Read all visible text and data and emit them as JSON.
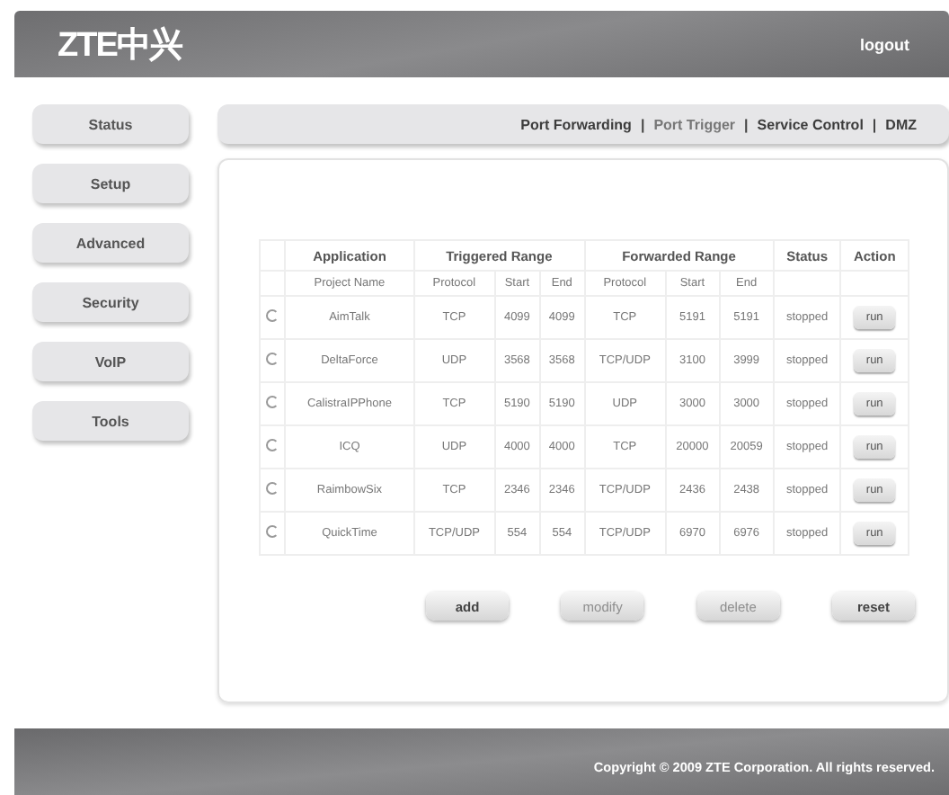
{
  "header": {
    "logo": "ZTE中兴",
    "logout": "logout"
  },
  "sidebar": {
    "items": [
      {
        "label": "Status",
        "selected": false
      },
      {
        "label": "Setup",
        "selected": false
      },
      {
        "label": "Advanced",
        "selected": false
      },
      {
        "label": "Security",
        "selected": false
      },
      {
        "label": "VoIP",
        "selected": false
      },
      {
        "label": "Tools",
        "selected": false
      }
    ]
  },
  "tab_separator": "|",
  "tabs": [
    {
      "label": "Port Forwarding",
      "selected": false
    },
    {
      "label": "Port Trigger",
      "selected": true
    },
    {
      "label": "Service Control",
      "selected": false
    },
    {
      "label": "DMZ",
      "selected": false
    }
  ],
  "table": {
    "groups": [
      "Application",
      "Triggered Range",
      "Forwarded Range",
      "Status",
      "Action"
    ],
    "columns": [
      "Project Name",
      "Protocol",
      "Start",
      "End",
      "Protocol",
      "Start",
      "End"
    ],
    "rows": [
      {
        "selected": false,
        "name": "AimTalk",
        "t_proto": "TCP",
        "t_start": "4099",
        "t_end": "4099",
        "f_proto": "TCP",
        "f_start": "5191",
        "f_end": "5191",
        "status": "stopped",
        "action": "run"
      },
      {
        "selected": false,
        "name": "DeltaForce",
        "t_proto": "UDP",
        "t_start": "3568",
        "t_end": "3568",
        "f_proto": "TCP/UDP",
        "f_start": "3100",
        "f_end": "3999",
        "status": "stopped",
        "action": "run"
      },
      {
        "selected": false,
        "name": "CalistraIPPhone",
        "t_proto": "TCP",
        "t_start": "5190",
        "t_end": "5190",
        "f_proto": "UDP",
        "f_start": "3000",
        "f_end": "3000",
        "status": "stopped",
        "action": "run"
      },
      {
        "selected": false,
        "name": "ICQ",
        "t_proto": "UDP",
        "t_start": "4000",
        "t_end": "4000",
        "f_proto": "TCP",
        "f_start": "20000",
        "f_end": "20059",
        "status": "stopped",
        "action": "run"
      },
      {
        "selected": false,
        "name": "RaimbowSix",
        "t_proto": "TCP",
        "t_start": "2346",
        "t_end": "2346",
        "f_proto": "TCP/UDP",
        "f_start": "2436",
        "f_end": "2438",
        "status": "stopped",
        "action": "run"
      },
      {
        "selected": false,
        "name": "QuickTime",
        "t_proto": "TCP/UDP",
        "t_start": "554",
        "t_end": "554",
        "f_proto": "TCP/UDP",
        "f_start": "6970",
        "f_end": "6976",
        "status": "stopped",
        "action": "run"
      }
    ]
  },
  "buttons": [
    {
      "label": "add",
      "disabled": false
    },
    {
      "label": "modify",
      "disabled": true
    },
    {
      "label": "delete",
      "disabled": true
    },
    {
      "label": "reset",
      "disabled": false
    }
  ],
  "footer": "Copyright © 2009 ZTE Corporation. All rights reserved."
}
